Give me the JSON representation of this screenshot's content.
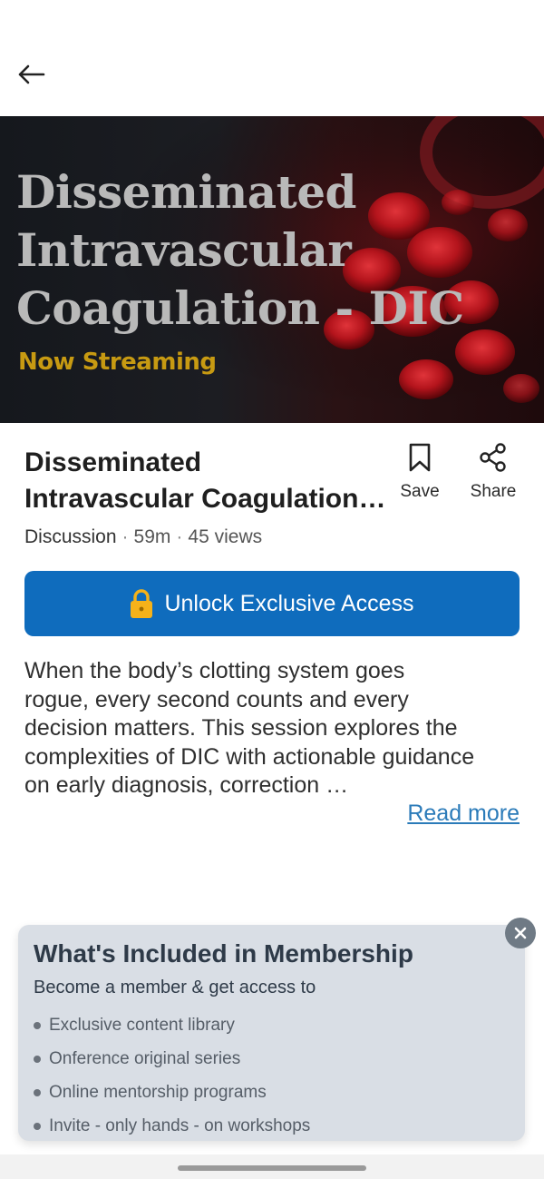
{
  "header": {
    "back_icon": "arrow-left-icon"
  },
  "hero": {
    "title_lines": [
      "Disseminated",
      "Intravascular",
      "Coagulation - DIC"
    ],
    "subtitle": "Now Streaming",
    "title_color": "#b9b9b9",
    "subtitle_color": "#c79a12"
  },
  "video": {
    "title_lines": [
      "Disseminated",
      "Intravascular Coagulation - DIC"
    ],
    "category": "Discussion",
    "duration": "59m",
    "views": "45 views"
  },
  "actions": {
    "save": {
      "label": "Save",
      "icon": "bookmark-icon"
    },
    "share": {
      "label": "Share",
      "icon": "share-icon"
    }
  },
  "unlock": {
    "label": "Unlock Exclusive Access",
    "icon": "lock-icon",
    "color": "#0f6cbd"
  },
  "description": {
    "lines": [
      "When the body’s clotting system goes",
      "rogue, every second counts and every",
      "decision matters. This session explores the",
      "complexities of DIC with actionable guidance",
      "on early diagnosis, correction …"
    ],
    "read_more": "Read more"
  },
  "membership": {
    "title": "What's Included in Membership",
    "subtitle": "Become a member & get access to",
    "items": [
      "Exclusive content library",
      "Onference original series",
      "Online mentorship programs",
      "Invite - only hands - on workshops"
    ],
    "close_icon": "close-icon"
  }
}
